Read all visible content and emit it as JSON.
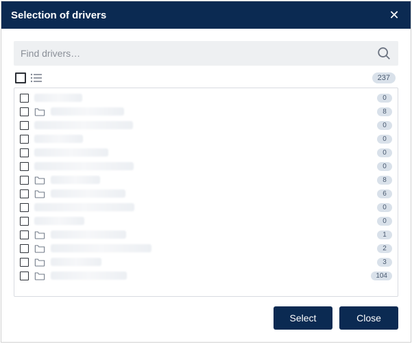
{
  "dialog": {
    "title": "Selection of drivers",
    "close_glyph": "✕"
  },
  "search": {
    "placeholder": "Find drivers…",
    "value": ""
  },
  "toolbar": {
    "total_count": "237"
  },
  "rows": [
    {
      "folder": false,
      "count": "0"
    },
    {
      "folder": true,
      "count": "8"
    },
    {
      "folder": false,
      "count": "0"
    },
    {
      "folder": false,
      "count": "0"
    },
    {
      "folder": false,
      "count": "0"
    },
    {
      "folder": false,
      "count": "0"
    },
    {
      "folder": true,
      "count": "8"
    },
    {
      "folder": true,
      "count": "6"
    },
    {
      "folder": false,
      "count": "0"
    },
    {
      "folder": false,
      "count": "0"
    },
    {
      "folder": true,
      "count": "1"
    },
    {
      "folder": true,
      "count": "2"
    },
    {
      "folder": true,
      "count": "3"
    },
    {
      "folder": true,
      "count": "104"
    }
  ],
  "buttons": {
    "select": "Select",
    "close": "Close"
  }
}
